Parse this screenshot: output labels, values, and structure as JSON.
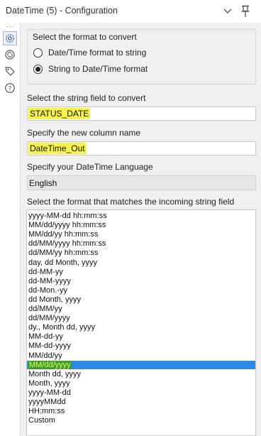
{
  "window": {
    "title": "DateTime (5) - Configuration"
  },
  "sidebar": {
    "icons": [
      "gear-icon",
      "refresh-arrows-icon",
      "tag-icon",
      "help-icon"
    ]
  },
  "format_group": {
    "title": "Select the format to convert",
    "options": [
      {
        "label": "Date/Time format to string",
        "checked": false
      },
      {
        "label": "String to Date/Time format",
        "checked": true
      }
    ]
  },
  "string_field": {
    "label": "Select the string field to convert",
    "value": "STATUS_DATE"
  },
  "new_column": {
    "label": "Specify the new column name",
    "value": "DateTime_Out"
  },
  "language": {
    "label": "Specify your DateTime Language",
    "value": "English"
  },
  "format_list": {
    "label": "Select the format that matches the incoming string field",
    "selected_index": 16,
    "items": [
      "yyyy-MM-dd hh:mm:ss",
      "MM/dd/yyyy hh:mm:ss",
      "MM/dd/yy hh:mm:ss",
      "dd/MM/yyyy hh:mm:ss",
      "dd/MM/yy hh:mm:ss",
      "day, dd Month, yyyy",
      "dd-MM-yy",
      "dd-MM-yyyy",
      "dd-Mon.-yy",
      "dd Month, yyyy",
      "dd/MM/yy",
      "dd/MM/yyyy",
      "dy., Month dd, yyyy",
      "MM-dd-yy",
      "MM-dd-yyyy",
      "MM/dd/yy",
      "MM/dd/yyyy",
      "Month dd, yyyy",
      "Month, yyyy",
      "yyyy-MM-dd",
      "yyyyMMdd",
      "HH:mm:ss",
      "Custom"
    ]
  }
}
